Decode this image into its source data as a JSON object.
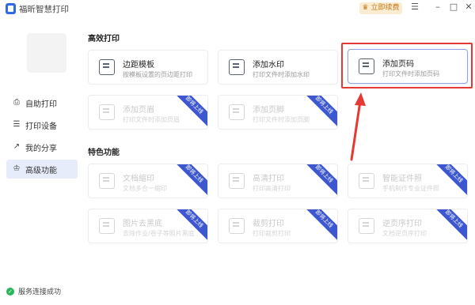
{
  "app": {
    "title": "福昕智慧打印",
    "vip_label": "立即续费",
    "menu_icon": "hamburger-icon",
    "minimize_icon": "minimize-icon",
    "maximize_icon": "maximize-icon",
    "close_icon": "close-icon"
  },
  "sidebar": {
    "items": [
      {
        "label": "自助打印",
        "icon": "printer-icon"
      },
      {
        "label": "打印设备",
        "icon": "device-icon"
      },
      {
        "label": "我的分享",
        "icon": "share-icon"
      },
      {
        "label": "高级功能",
        "icon": "crown-icon"
      }
    ],
    "active_index": 3,
    "status": "服务连接成功"
  },
  "sections": {
    "efficient": {
      "title": "高效打印",
      "cards": [
        {
          "title": "边距模板",
          "subtitle": "按模板设置的页边距打印",
          "disabled": false
        },
        {
          "title": "添加水印",
          "subtitle": "打印文件时添加水印",
          "disabled": false
        },
        {
          "title": "添加页码",
          "subtitle": "打印文件时添加页码",
          "disabled": false,
          "selected": true
        },
        {
          "title": "添加页眉",
          "subtitle": "打印文件时添加页眉",
          "disabled": true,
          "ribbon": "即将上线"
        },
        {
          "title": "添加页脚",
          "subtitle": "打印文件时添加页脚",
          "disabled": true,
          "ribbon": "即将上线"
        }
      ]
    },
    "features": {
      "title": "特色功能",
      "cards": [
        {
          "title": "文档缩印",
          "subtitle": "文档多合一缩印",
          "disabled": true,
          "ribbon": "即将上线"
        },
        {
          "title": "高清打印",
          "subtitle": "打印高清打印",
          "disabled": true,
          "ribbon": "即将上线"
        },
        {
          "title": "智能证件照",
          "subtitle": "手机制作专业证件照",
          "disabled": true,
          "ribbon": "即将上线"
        },
        {
          "title": "图片去黑底",
          "subtitle": "去除作业/卷子等照片黑底",
          "disabled": true,
          "ribbon": "即将上线"
        },
        {
          "title": "裁剪打印",
          "subtitle": "打印裁剪打印",
          "disabled": true,
          "ribbon": "即将上线"
        },
        {
          "title": "逆页序打印",
          "subtitle": "文档逆页序打印",
          "disabled": true,
          "ribbon": "即将上线"
        }
      ]
    }
  },
  "colors": {
    "accent": "#3c57cf",
    "highlight": "#e53935",
    "status_ok": "#27b65a"
  }
}
